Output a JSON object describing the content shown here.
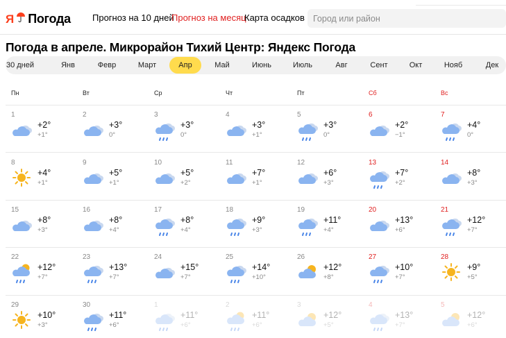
{
  "header": {
    "logo_ya": "Я",
    "logo_text": "Погода",
    "nav": [
      {
        "label": "Прогноз на 10 дней",
        "active": false
      },
      {
        "label": "Прогноз на месяц",
        "active": true
      },
      {
        "label": "Карта осадков",
        "active": false
      }
    ],
    "search_placeholder": "Город или район"
  },
  "page_title": "Погода в апреле. Микрорайон Тихий Центр: Яндекс Погода",
  "tabs": [
    {
      "label": "30 дней",
      "active": false
    },
    {
      "label": "Янв",
      "active": false
    },
    {
      "label": "Февр",
      "active": false
    },
    {
      "label": "Март",
      "active": false
    },
    {
      "label": "Апр",
      "active": true
    },
    {
      "label": "Май",
      "active": false
    },
    {
      "label": "Июнь",
      "active": false
    },
    {
      "label": "Июль",
      "active": false
    },
    {
      "label": "Авг",
      "active": false
    },
    {
      "label": "Сент",
      "active": false
    },
    {
      "label": "Окт",
      "active": false
    },
    {
      "label": "Нояб",
      "active": false
    },
    {
      "label": "Дек",
      "active": false
    }
  ],
  "weekdays": [
    {
      "label": "Пн",
      "weekend": false
    },
    {
      "label": "Вт",
      "weekend": false
    },
    {
      "label": "Ср",
      "weekend": false
    },
    {
      "label": "Чт",
      "weekend": false
    },
    {
      "label": "Пт",
      "weekend": false
    },
    {
      "label": "Сб",
      "weekend": true
    },
    {
      "label": "Вс",
      "weekend": true
    }
  ],
  "weeks": [
    [
      {
        "date": "1",
        "icon": "partly-cloudy-icon",
        "max": "+2°",
        "min": "+1°"
      },
      {
        "date": "2",
        "icon": "partly-cloudy-icon",
        "max": "+3°",
        "min": "0°"
      },
      {
        "date": "3",
        "icon": "cloud-rain-icon",
        "max": "+3°",
        "min": "0°"
      },
      {
        "date": "4",
        "icon": "partly-cloudy-icon",
        "max": "+3°",
        "min": "+1°"
      },
      {
        "date": "5",
        "icon": "cloud-rain-icon",
        "max": "+3°",
        "min": "0°"
      },
      {
        "date": "6",
        "icon": "partly-cloudy-icon",
        "max": "+2°",
        "min": "−1°"
      },
      {
        "date": "7",
        "icon": "cloud-rain-icon",
        "max": "+4°",
        "min": "0°"
      }
    ],
    [
      {
        "date": "8",
        "icon": "sun-icon",
        "max": "+4°",
        "min": "+1°"
      },
      {
        "date": "9",
        "icon": "partly-cloudy-icon",
        "max": "+5°",
        "min": "+1°"
      },
      {
        "date": "10",
        "icon": "partly-cloudy-icon",
        "max": "+5°",
        "min": "+2°"
      },
      {
        "date": "11",
        "icon": "partly-cloudy-icon",
        "max": "+7°",
        "min": "+1°"
      },
      {
        "date": "12",
        "icon": "partly-cloudy-icon",
        "max": "+6°",
        "min": "+3°"
      },
      {
        "date": "13",
        "icon": "cloud-rain-icon",
        "max": "+7°",
        "min": "+2°"
      },
      {
        "date": "14",
        "icon": "partly-cloudy-icon",
        "max": "+8°",
        "min": "+3°"
      }
    ],
    [
      {
        "date": "15",
        "icon": "partly-cloudy-icon",
        "max": "+8°",
        "min": "+3°"
      },
      {
        "date": "16",
        "icon": "partly-cloudy-icon",
        "max": "+8°",
        "min": "+4°"
      },
      {
        "date": "17",
        "icon": "cloud-rain-icon",
        "max": "+8°",
        "min": "+4°"
      },
      {
        "date": "18",
        "icon": "cloud-rain-icon",
        "max": "+9°",
        "min": "+3°"
      },
      {
        "date": "19",
        "icon": "cloud-rain-icon",
        "max": "+11°",
        "min": "+4°"
      },
      {
        "date": "20",
        "icon": "partly-cloudy-icon",
        "max": "+13°",
        "min": "+6°"
      },
      {
        "date": "21",
        "icon": "cloud-rain-icon",
        "max": "+12°",
        "min": "+7°"
      }
    ],
    [
      {
        "date": "22",
        "icon": "sun-cloud-rain-icon",
        "max": "+12°",
        "min": "+7°"
      },
      {
        "date": "23",
        "icon": "cloud-rain-icon",
        "max": "+13°",
        "min": "+7°"
      },
      {
        "date": "24",
        "icon": "partly-cloudy-icon",
        "max": "+15°",
        "min": "+7°"
      },
      {
        "date": "25",
        "icon": "cloud-rain-icon",
        "max": "+14°",
        "min": "+10°"
      },
      {
        "date": "26",
        "icon": "sun-cloud-icon",
        "max": "+12°",
        "min": "+8°"
      },
      {
        "date": "27",
        "icon": "cloud-rain-icon",
        "max": "+10°",
        "min": "+7°"
      },
      {
        "date": "28",
        "icon": "sun-icon",
        "max": "+9°",
        "min": "+5°"
      }
    ],
    [
      {
        "date": "29",
        "icon": "sun-icon",
        "max": "+10°",
        "min": "+3°"
      },
      {
        "date": "30",
        "icon": "cloud-rain-icon",
        "max": "+11°",
        "min": "+6°"
      },
      {
        "date": "1",
        "icon": "cloud-rain-icon",
        "max": "+11°",
        "min": "+6°",
        "faded": true
      },
      {
        "date": "2",
        "icon": "sun-cloud-rain-icon",
        "max": "+11°",
        "min": "+6°",
        "faded": true
      },
      {
        "date": "3",
        "icon": "sun-cloud-icon",
        "max": "+12°",
        "min": "+5°",
        "faded": true
      },
      {
        "date": "4",
        "icon": "cloud-rain-icon",
        "max": "+13°",
        "min": "+7°",
        "faded": true
      },
      {
        "date": "5",
        "icon": "sun-cloud-icon",
        "max": "+12°",
        "min": "+6°",
        "faded": true
      }
    ]
  ],
  "colors": {
    "accent_yellow": "#ffdb4d",
    "weekend_red": "#e02020",
    "brand_red": "#fc3f1d",
    "cloud_blue": "#8ab4f0",
    "sun_yellow": "#f6b41f"
  }
}
